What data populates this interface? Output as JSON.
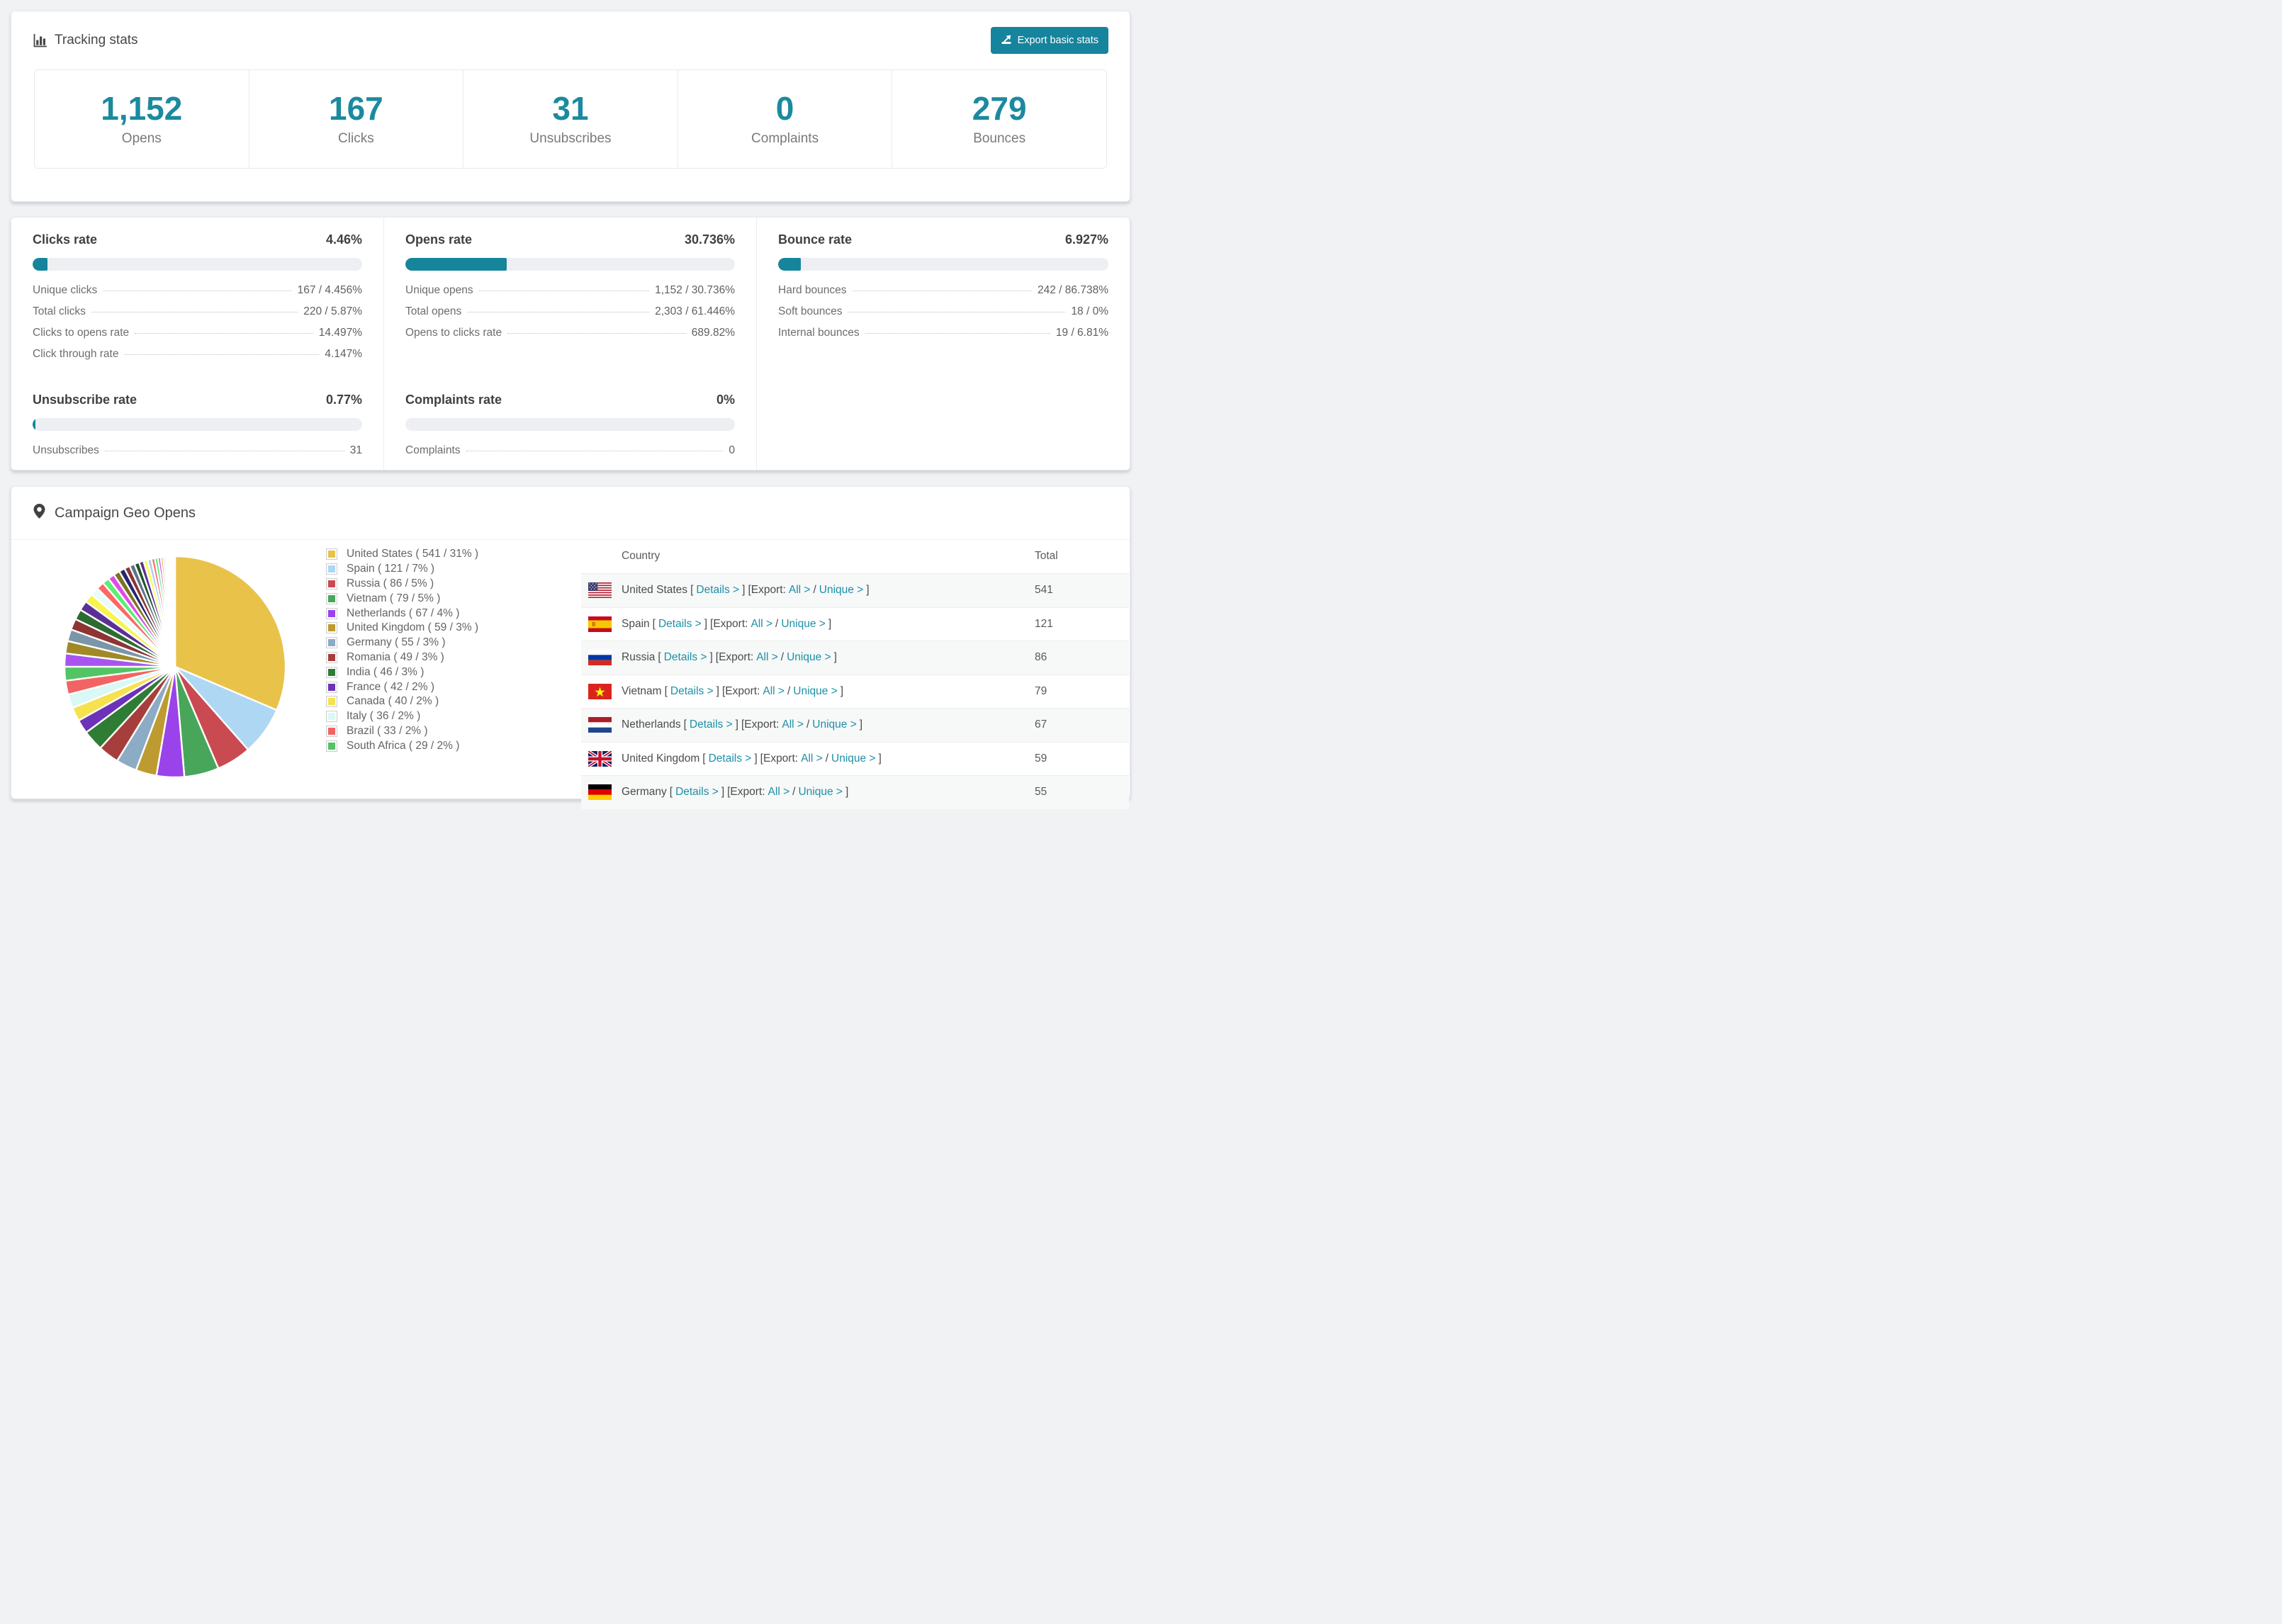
{
  "tracking_stats": {
    "title": "Tracking stats",
    "export_label": "Export basic stats",
    "summary": [
      {
        "value": "1,152",
        "label": "Opens"
      },
      {
        "value": "167",
        "label": "Clicks"
      },
      {
        "value": "31",
        "label": "Unsubscribes"
      },
      {
        "value": "0",
        "label": "Complaints"
      },
      {
        "value": "279",
        "label": "Bounces"
      }
    ]
  },
  "rates": {
    "blocks": [
      {
        "title": "Clicks rate",
        "value": "4.46%",
        "percent": 4.46,
        "items": [
          {
            "label": "Unique clicks",
            "value": "167 / 4.456%"
          },
          {
            "label": "Total clicks",
            "value": "220 / 5.87%"
          },
          {
            "label": "Clicks to opens rate",
            "value": "14.497%"
          },
          {
            "label": "Click through rate",
            "value": "4.147%"
          }
        ]
      },
      {
        "title": "Opens rate",
        "value": "30.736%",
        "percent": 30.736,
        "items": [
          {
            "label": "Unique opens",
            "value": "1,152 / 30.736%"
          },
          {
            "label": "Total opens",
            "value": "2,303 / 61.446%"
          },
          {
            "label": "Opens to clicks rate",
            "value": "689.82%"
          }
        ]
      },
      {
        "title": "Bounce rate",
        "value": "6.927%",
        "percent": 6.927,
        "items": [
          {
            "label": "Hard bounces",
            "value": "242 / 86.738%"
          },
          {
            "label": "Soft bounces",
            "value": "18 / 0%"
          },
          {
            "label": "Internal bounces",
            "value": "19 / 6.81%"
          }
        ]
      },
      {
        "title": "Unsubscribe rate",
        "value": "0.77%",
        "percent": 0.77,
        "items": [
          {
            "label": "Unsubscribes",
            "value": "31"
          }
        ]
      },
      {
        "title": "Complaints rate",
        "value": "0%",
        "percent": 0,
        "items": [
          {
            "label": "Complaints",
            "value": "0"
          }
        ]
      }
    ]
  },
  "geo": {
    "title": "Campaign Geo Opens",
    "legend": [
      {
        "label": "United States ( 541 / 31% )",
        "color": "#e9c24a"
      },
      {
        "label": "Spain ( 121 / 7% )",
        "color": "#aed7f3"
      },
      {
        "label": "Russia ( 86 / 5% )",
        "color": "#ca4a52"
      },
      {
        "label": "Vietnam ( 79 / 5% )",
        "color": "#47a65a"
      },
      {
        "label": "Netherlands ( 67 / 4% )",
        "color": "#9b43ea"
      },
      {
        "label": "United Kingdom ( 59 / 3% )",
        "color": "#bd9b30"
      },
      {
        "label": "Germany ( 55 / 3% )",
        "color": "#8cabc4"
      },
      {
        "label": "Romania ( 49 / 3% )",
        "color": "#a63f3c"
      },
      {
        "label": "India ( 46 / 3% )",
        "color": "#2f7c35"
      },
      {
        "label": "France ( 42 / 2% )",
        "color": "#6c33b8"
      },
      {
        "label": "Canada ( 40 / 2% )",
        "color": "#f6e14e"
      },
      {
        "label": "Italy ( 36 / 2% )",
        "color": "#d9f8f6"
      },
      {
        "label": "Brazil ( 33 / 2% )",
        "color": "#f26464"
      },
      {
        "label": "South Africa ( 29 / 2% )",
        "color": "#53c465"
      }
    ],
    "chart_data": {
      "type": "pie",
      "title": "Campaign Geo Opens",
      "slices": [
        {
          "label": "United States",
          "value": 541,
          "pct": 31,
          "color": "#e9c24a"
        },
        {
          "label": "Spain",
          "value": 121,
          "pct": 7,
          "color": "#aed7f3"
        },
        {
          "label": "Russia",
          "value": 86,
          "pct": 5,
          "color": "#ca4a52"
        },
        {
          "label": "Vietnam",
          "value": 79,
          "pct": 5,
          "color": "#47a65a"
        },
        {
          "label": "Netherlands",
          "value": 67,
          "pct": 4,
          "color": "#9b43ea"
        },
        {
          "label": "United Kingdom",
          "value": 59,
          "pct": 3,
          "color": "#bd9b30"
        },
        {
          "label": "Germany",
          "value": 55,
          "pct": 3,
          "color": "#8cabc4"
        },
        {
          "label": "Romania",
          "value": 49,
          "pct": 3,
          "color": "#a63f3c"
        },
        {
          "label": "India",
          "value": 46,
          "pct": 3,
          "color": "#2f7c35"
        },
        {
          "label": "France",
          "value": 42,
          "pct": 2,
          "color": "#6c33b8"
        },
        {
          "label": "Canada",
          "value": 40,
          "pct": 2,
          "color": "#f6e14e"
        },
        {
          "label": "Italy",
          "value": 36,
          "pct": 2,
          "color": "#d9f8f6"
        },
        {
          "label": "Brazil",
          "value": 33,
          "pct": 2,
          "color": "#f26464"
        },
        {
          "label": "South Africa",
          "value": 29,
          "pct": 2,
          "color": "#53c465"
        }
      ],
      "other_slices": {
        "note": "unlabeled small countries fanning to 12 o'clock",
        "values": [
          1.9,
          1.8,
          1.7,
          1.6,
          1.5,
          1.4,
          1.3,
          1.2,
          1.1,
          1.0,
          0.95,
          0.9,
          0.85,
          0.8,
          0.75,
          0.7,
          0.65,
          0.6,
          0.55,
          0.5,
          0.45,
          0.4,
          0.35,
          0.3,
          0.26,
          0.23,
          0.2,
          0.17,
          0.14,
          0.12,
          0.1,
          0.08,
          0.06,
          0.05
        ],
        "colors": [
          "#a855f0",
          "#a08a28",
          "#7b95a9",
          "#8e3434",
          "#2c6b31",
          "#5c2f96",
          "#f8f44e",
          "#eafbfa",
          "#ff6666",
          "#5bee73",
          "#e24aea",
          "#7c7420",
          "#23266e",
          "#8e3434",
          "#5e7488",
          "#1f5429",
          "#5b2f91",
          "#f7ff5a",
          "#aacfee",
          "#ff6b6b",
          "#49f06c",
          "#e24ae8",
          "#d4af37",
          "#99ccee",
          "#e84949",
          "#3adb63",
          "#aa55ee",
          "#c9a227",
          "#d44ae0",
          "#44bb66",
          "#ee5555",
          "#55cc77",
          "#8a2be2",
          "#ddbb33"
        ]
      }
    },
    "table": {
      "columns": [
        "Country",
        "Total"
      ],
      "link_labels": {
        "open": "[",
        "details": "Details >",
        "close": "]",
        "export": "[Export:",
        "all": "All >",
        "slash": "/",
        "unique": "Unique >",
        "close2": "]"
      },
      "rows": [
        {
          "country": "United States",
          "total": "541",
          "flag": "us"
        },
        {
          "country": "Spain",
          "total": "121",
          "flag": "es"
        },
        {
          "country": "Russia",
          "total": "86",
          "flag": "ru"
        },
        {
          "country": "Vietnam",
          "total": "79",
          "flag": "vn"
        },
        {
          "country": "Netherlands",
          "total": "67",
          "flag": "nl"
        },
        {
          "country": "United Kingdom",
          "total": "59",
          "flag": "gb"
        },
        {
          "country": "Germany",
          "total": "55",
          "flag": "de"
        }
      ]
    }
  }
}
